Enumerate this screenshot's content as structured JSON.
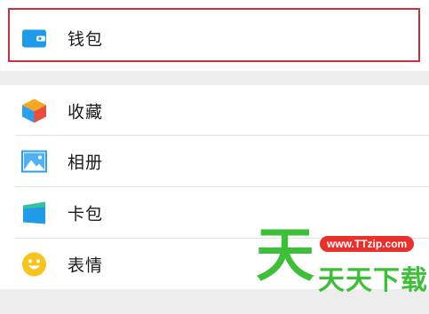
{
  "wallet": {
    "label": "钱包",
    "icon": "wallet-icon"
  },
  "menu": [
    {
      "label": "收藏",
      "icon": "favorites-cube-icon"
    },
    {
      "label": "相册",
      "icon": "photo-album-icon"
    },
    {
      "label": "卡包",
      "icon": "card-wallet-icon"
    },
    {
      "label": "表情",
      "icon": "emoji-smiley-icon"
    }
  ],
  "watermark": {
    "glyph": "天",
    "site": "www.TTzip.com",
    "name": "天天下载"
  },
  "colors": {
    "highlight": "#c8323c",
    "wallet_icon": "#1f9be8",
    "watermark_green": "#3ebf3a",
    "watermark_red": "#e8312a"
  }
}
